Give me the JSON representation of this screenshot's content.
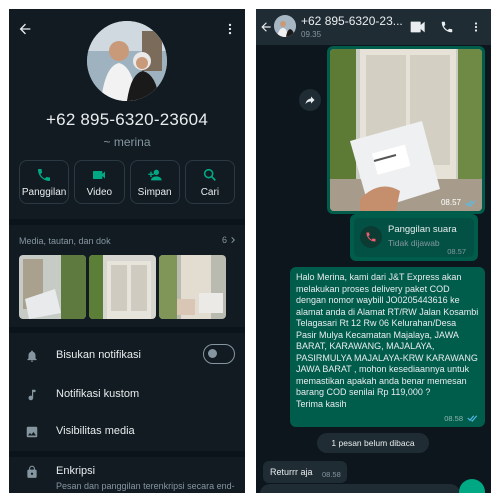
{
  "contact": {
    "phone": "+62 895-6320-23604",
    "name": "~ merina"
  },
  "actions": [
    {
      "label": "Panggilan",
      "icon": "phone-icon"
    },
    {
      "label": "Video",
      "icon": "video-icon"
    },
    {
      "label": "Simpan",
      "icon": "add-person-icon"
    },
    {
      "label": "Cari",
      "icon": "search-icon"
    }
  ],
  "media": {
    "title": "Media, tautan, dan dok",
    "count": "6"
  },
  "settings": {
    "mute": "Bisukan notifikasi",
    "custom_notif": "Notifikasi kustom",
    "media_visibility": "Visibilitas media",
    "encryption": "Enkripsi",
    "encryption_sub": "Pesan dan panggilan terenkripsi secara end-to-end. Ketuk untuk"
  },
  "chat": {
    "title": "+62 895-6320-23...",
    "subtitle": "09.35",
    "image_time": "08.57",
    "call": {
      "title": "Panggilan suara",
      "status": "Tidak dijawab",
      "time": "08.57"
    },
    "text_message": "Halo Merina, kami dari J&T Express akan melakukan proses delivery paket COD dengan nomor waybill JO0205443616 ke alamat anda di Alamat RT/RW Jalan Kosambi Telagasari Rt 12 Rw 06 Kelurahan/Desa Pasir Mulya Kecamatan Majalaya, JAWA BARAT, KARAWANG, MAJALAYA, PASIRMULYA MAJALAYA-KRW KARAWANG JAWA BARAT , mohon kesediaannya untuk memastikan apakah anda benar memesan barang COD senilai Rp 119,000 ?\nTerima kasih",
    "text_time": "08.58",
    "unread_label": "1 pesan belum dibaca",
    "incoming_text": "Returrr aja",
    "incoming_time": "08.58"
  },
  "colors": {
    "accent": "#00a884",
    "bubble_out": "#005c4b",
    "panel": "#111b21",
    "read_ticks": "#53bdeb",
    "missed_call": "#f15c6d"
  }
}
